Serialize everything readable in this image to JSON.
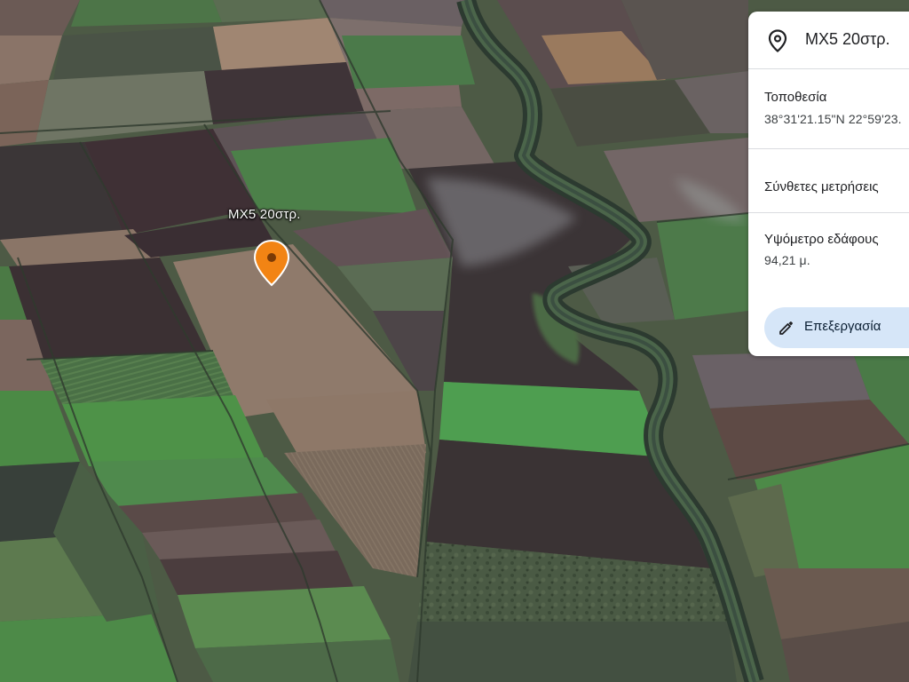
{
  "placemark": {
    "label": "MX5 20στρ.",
    "pin_color": "#f28414"
  },
  "info_panel": {
    "title": "MX5 20στρ.",
    "title_icon": "location-pin-icon",
    "location_label": "Τοποθεσία",
    "location_value": "38°31'21.15\"N 22°59'23.",
    "measurements_label": "Σύνθετες μετρήσεις",
    "elevation_label": "Υψόμετρο εδάφους",
    "elevation_value": "94,21 μ.",
    "edit_label": "Επεξεργασία",
    "edit_icon": "pencil-icon"
  }
}
